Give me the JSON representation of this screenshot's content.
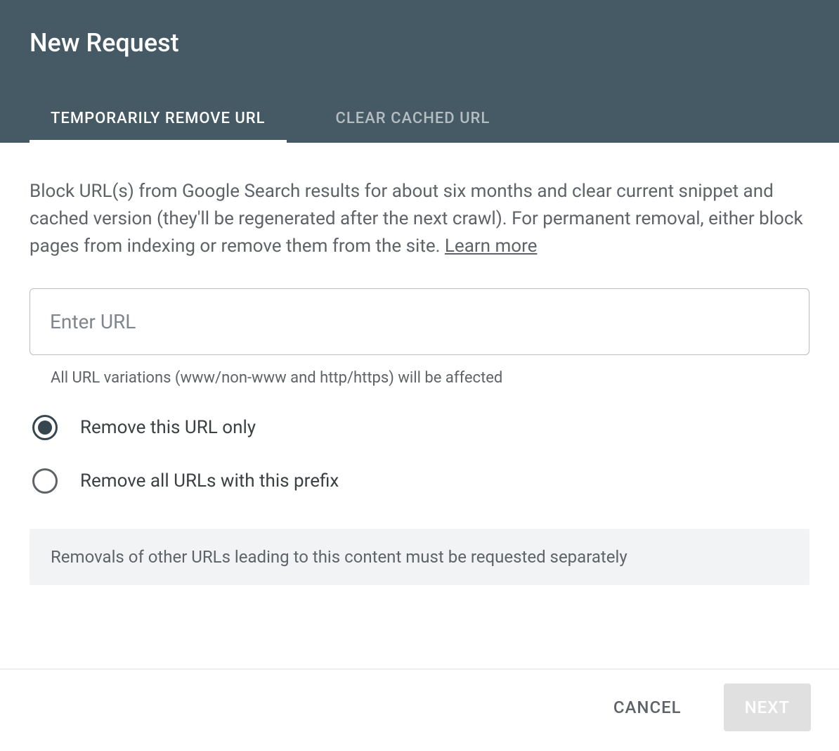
{
  "header": {
    "title": "New Request"
  },
  "tabs": [
    {
      "label": "TEMPORARILY REMOVE URL",
      "active": true
    },
    {
      "label": "CLEAR CACHED URL",
      "active": false
    }
  ],
  "content": {
    "description": "Block URL(s) from Google Search results for about six months and clear current snippet and cached version (they'll be regenerated after the next crawl). For permanent removal, either block pages from indexing or remove them from the site. ",
    "learn_more_label": "Learn more",
    "url_input": {
      "placeholder": "Enter URL",
      "value": ""
    },
    "helper_text": "All URL variations (www/non-www and http/https) will be affected",
    "radio_options": [
      {
        "label": "Remove this URL only",
        "selected": true
      },
      {
        "label": "Remove all URLs with this prefix",
        "selected": false
      }
    ],
    "info_box": "Removals of other URLs leading to this content must be requested separately"
  },
  "footer": {
    "cancel_label": "CANCEL",
    "next_label": "NEXT"
  }
}
